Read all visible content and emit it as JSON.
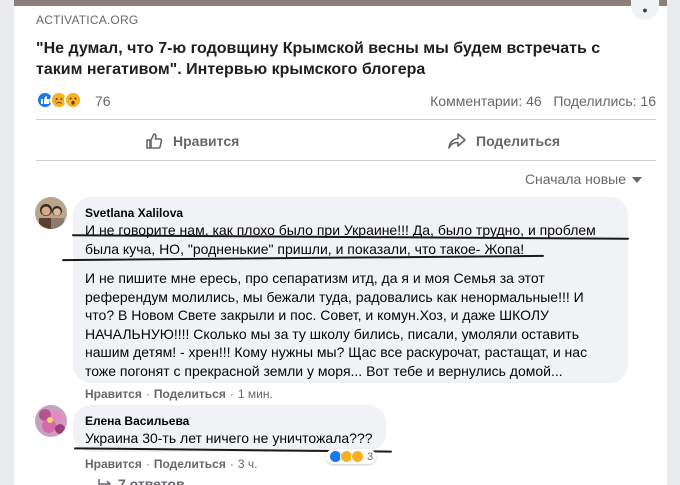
{
  "post": {
    "source": "ACTIVATICA.ORG",
    "more_icon": "•",
    "title": "\"Не думал, что 7-ю годовщину Крымской весны мы будем встречать с таким негативом\". Интервью крымского блогера",
    "reaction_count": "76",
    "comments": "Комментарии: 46",
    "shares": "Поделились: 16",
    "like_label": "Нравится",
    "share_label": "Поделиться",
    "sort_label": "Сначала новые",
    "colors": {
      "accent": "#1877f2",
      "emoji": "#f7b125",
      "muted": "#65676b",
      "bubble": "#f0f2f5"
    }
  },
  "comments": [
    {
      "author": "Svetlana Xalilova",
      "paragraphs": [
        "И не говорите нам, как плохо было при Украине!!! Да, было трудно, и проблем была куча, НО, \"родненькие\" пришли, и показали, что такое- Жопа!",
        "И не пишите мне ересь, про сепаратизм итд, да я и моя Семья за этот референдум молились, мы бежали туда, радовались как ненормальные!!! И что? В Новом Свете закрыли и пос. Совет, и комун.Хоз, и даже ШКОЛУ НАЧАЛЬНУЮ!!!! Сколько мы за ту школу бились, писали, умоляли оставить нашим детям! - хрен!!! Кому нужны мы? Щас все раскурочат, растащат, и нас тоже погонят с прекрасной земли у моря... Вот тебе и вернулись домой..."
      ],
      "like": "Нравится",
      "reply": "Поделиться",
      "time": "1 мин."
    },
    {
      "author": "Елена Васильева",
      "paragraphs": [
        "Украина 30-ть лет ничего не уничтожала???"
      ],
      "like": "Нравится",
      "reply": "Поделиться",
      "time": "3 ч.",
      "reaction_count": "3"
    }
  ],
  "replies_label": "7 ответов"
}
